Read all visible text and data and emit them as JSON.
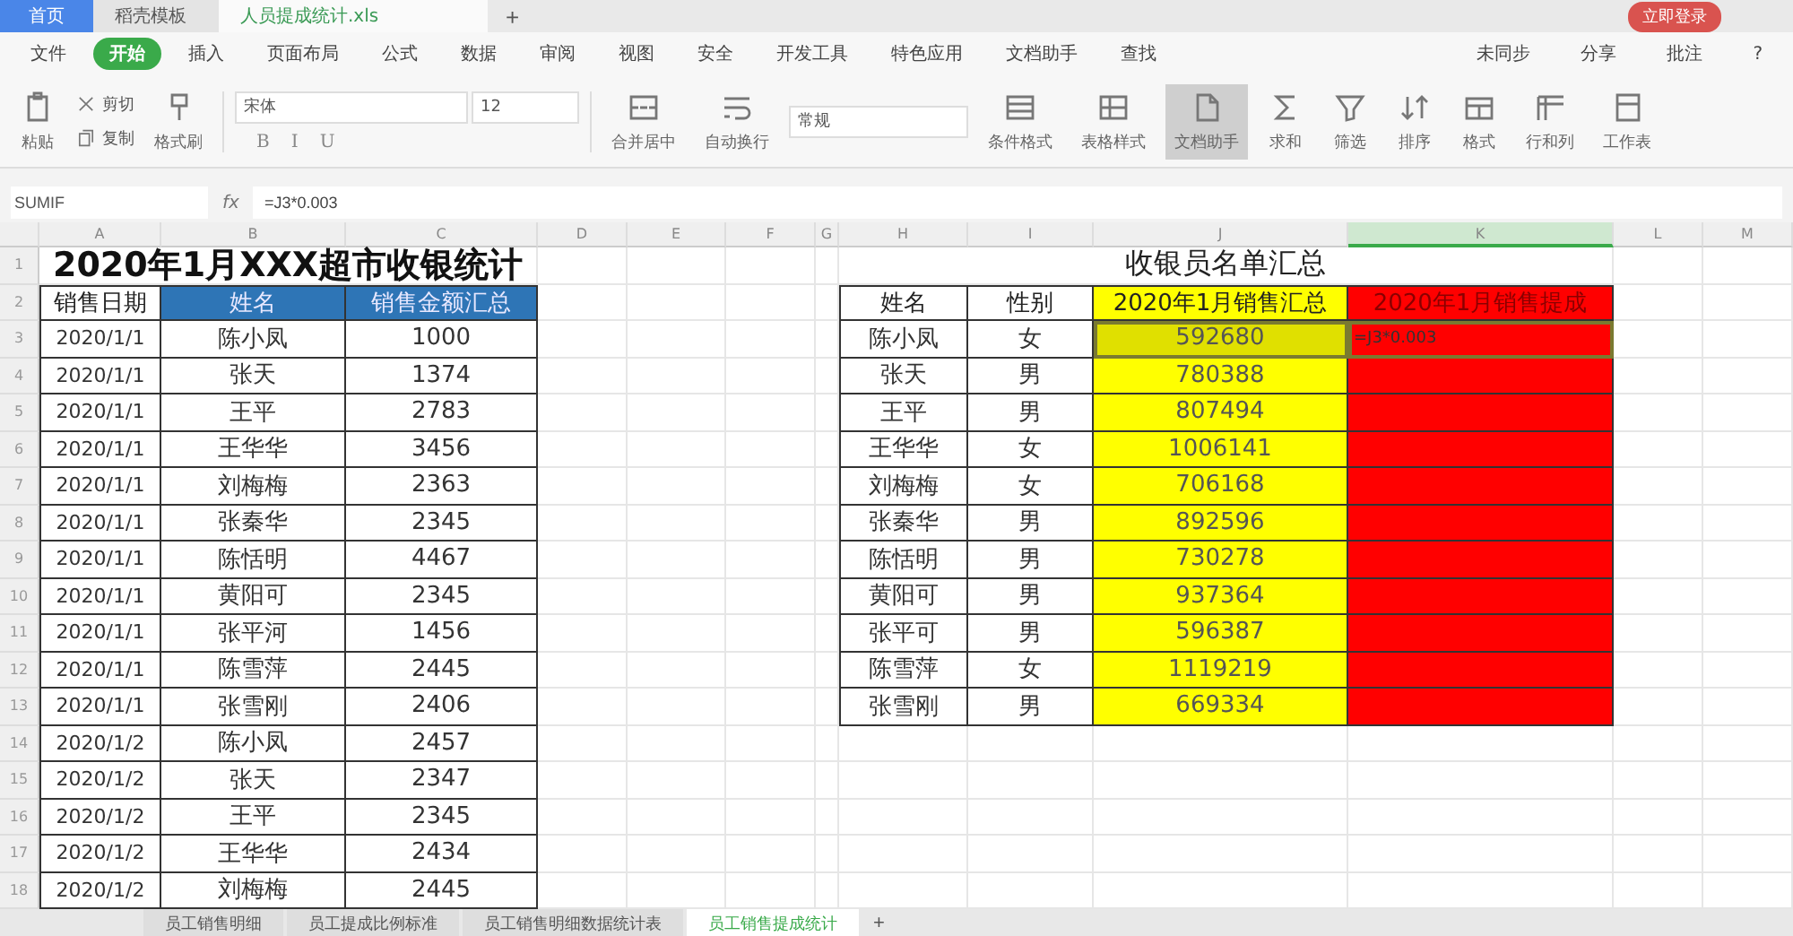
{
  "title_bar": {
    "tabs": [
      {
        "label": "首页",
        "selected": false,
        "kind": "home"
      },
      {
        "label": "稻壳模板",
        "selected": false,
        "kind": "docer"
      },
      {
        "label": "人员提成统计.xls",
        "selected": true,
        "kind": "sheet"
      }
    ],
    "new_tab": "+",
    "login": "立即登录"
  },
  "menu": {
    "file": "文件",
    "items": [
      {
        "label": "开始",
        "selected": true
      },
      {
        "label": "插入",
        "selected": false
      },
      {
        "label": "页面布局",
        "selected": false
      },
      {
        "label": "公式",
        "selected": false
      },
      {
        "label": "数据",
        "selected": false
      },
      {
        "label": "审阅",
        "selected": false
      },
      {
        "label": "视图",
        "selected": false
      },
      {
        "label": "安全",
        "selected": false
      },
      {
        "label": "开发工具",
        "selected": false
      },
      {
        "label": "特色应用",
        "selected": false
      },
      {
        "label": "文档助手",
        "selected": false
      }
    ],
    "search": "查找",
    "right": [
      "未同步",
      "分享",
      "批注"
    ],
    "help": "?"
  },
  "ribbon": {
    "clipboard": [
      {
        "label": "粘贴",
        "kind": "paste"
      },
      {
        "label": "剪切",
        "kind": "cut"
      },
      {
        "label": "复制",
        "kind": "copy"
      },
      {
        "label": "格式刷",
        "kind": "brush"
      }
    ],
    "font": "宋体",
    "size": "12",
    "format_buttons": [
      "B",
      "I",
      "U"
    ],
    "wrap": [
      {
        "label": "合并居中",
        "kind": "merge"
      },
      {
        "label": "自动换行",
        "kind": "wrap"
      }
    ],
    "number_format": "常规",
    "tools": [
      {
        "label": "条件格式",
        "kind": "cond",
        "selected": false
      },
      {
        "label": "表格样式",
        "kind": "style",
        "selected": false
      },
      {
        "label": "文档助手",
        "kind": "doc",
        "selected": true
      },
      {
        "label": "求和",
        "kind": "sum",
        "selected": false
      },
      {
        "label": "筛选",
        "kind": "filter",
        "selected": false
      },
      {
        "label": "排序",
        "kind": "sort",
        "selected": false
      },
      {
        "label": "格式",
        "kind": "format",
        "selected": false
      },
      {
        "label": "行和列",
        "kind": "rowcol",
        "selected": false
      },
      {
        "label": "工作表",
        "kind": "sheet",
        "selected": false
      }
    ]
  },
  "formula_bar": {
    "name_box": "SUMIF",
    "fx": "fx",
    "formula": "=J3*0.003"
  },
  "sheet": {
    "columns": [
      {
        "label": "A",
        "selected": false
      },
      {
        "label": "B",
        "selected": false
      },
      {
        "label": "C",
        "selected": false
      },
      {
        "label": "D",
        "selected": false
      },
      {
        "label": "E",
        "selected": false
      },
      {
        "label": "F",
        "selected": false
      },
      {
        "label": "G",
        "selected": false
      },
      {
        "label": "H",
        "selected": false
      },
      {
        "label": "I",
        "selected": false
      },
      {
        "label": "J",
        "selected": false
      },
      {
        "label": "K",
        "selected": true
      },
      {
        "label": "L",
        "selected": false
      },
      {
        "label": "M",
        "selected": false
      }
    ],
    "row_numbers": [
      "1",
      "2",
      "3",
      "4",
      "5",
      "6",
      "7",
      "8",
      "9",
      "10",
      "11",
      "12",
      "13",
      "14",
      "15",
      "16",
      "17",
      "18"
    ],
    "left_table": {
      "title": "2020年1月XXX超市收银统计",
      "headers": [
        {
          "text": "销售日期",
          "color": "#ffffff"
        },
        {
          "text": "姓名",
          "color": "#2e75b6"
        },
        {
          "text": "销售金额汇总",
          "color": "#2e75b6"
        }
      ],
      "rows": [
        [
          "2020/1/1",
          "陈小凤",
          "1000"
        ],
        [
          "2020/1/1",
          "张天",
          "1374"
        ],
        [
          "2020/1/1",
          "王平",
          "2783"
        ],
        [
          "2020/1/1",
          "王华华",
          "3456"
        ],
        [
          "2020/1/1",
          "刘梅梅",
          "2363"
        ],
        [
          "2020/1/1",
          "张秦华",
          "2345"
        ],
        [
          "2020/1/1",
          "陈恬明",
          "4467"
        ],
        [
          "2020/1/1",
          "黄阳可",
          "2345"
        ],
        [
          "2020/1/1",
          "张平河",
          "1456"
        ],
        [
          "2020/1/1",
          "陈雪萍",
          "2445"
        ],
        [
          "2020/1/1",
          "张雪刚",
          "2406"
        ],
        [
          "2020/1/2",
          "陈小凤",
          "2457"
        ],
        [
          "2020/1/2",
          "张天",
          "2347"
        ],
        [
          "2020/1/2",
          "王平",
          "2345"
        ],
        [
          "2020/1/2",
          "王华华",
          "2434"
        ],
        [
          "2020/1/2",
          "刘梅梅",
          "2445"
        ]
      ]
    },
    "right_table": {
      "title": "收银员名单汇总",
      "headers": [
        {
          "text": "姓名",
          "color": "#ffffff"
        },
        {
          "text": "性别",
          "color": "#ffffff"
        },
        {
          "text": "2020年1月销售汇总",
          "color": "#ffff00"
        },
        {
          "text": "2020年1月销售提成",
          "color": "#ff0000"
        }
      ],
      "rows": [
        {
          "cells": [
            "陈小凤",
            "女",
            "592680",
            "=J3*0.003"
          ],
          "selected": true
        },
        {
          "cells": [
            "张天",
            "男",
            "780388"
          ],
          "selected": false
        },
        {
          "cells": [
            "王平",
            "男",
            "807494"
          ],
          "selected": false
        },
        {
          "cells": [
            "王华华",
            "女",
            "1006141"
          ],
          "selected": false
        },
        {
          "cells": [
            "刘梅梅",
            "女",
            "706168"
          ],
          "selected": false
        },
        {
          "cells": [
            "张秦华",
            "男",
            "892596"
          ],
          "selected": false
        },
        {
          "cells": [
            "陈恬明",
            "男",
            "730278"
          ],
          "selected": false
        },
        {
          "cells": [
            "黄阳可",
            "男",
            "937364"
          ],
          "selected": false
        },
        {
          "cells": [
            "张平可",
            "男",
            "596387"
          ],
          "selected": false
        },
        {
          "cells": [
            "陈雪萍",
            "女",
            "1119219"
          ],
          "selected": false
        },
        {
          "cells": [
            "张雪刚",
            "男",
            "669334"
          ],
          "selected": false
        }
      ]
    }
  },
  "sheet_tabs": {
    "tabs": [
      {
        "label": "员工销售明细",
        "selected": false
      },
      {
        "label": "员工提成比例标准",
        "selected": false
      },
      {
        "label": "员工销售明细数据统计表",
        "selected": false
      },
      {
        "label": "员工销售提成统计",
        "selected": true
      }
    ],
    "add": "+"
  }
}
